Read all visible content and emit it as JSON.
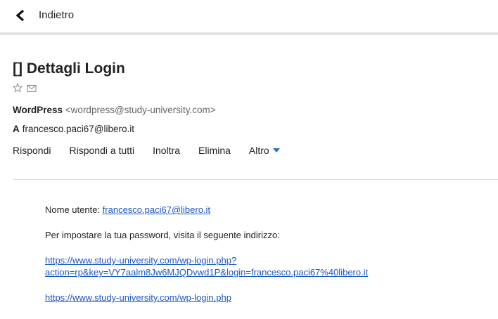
{
  "header": {
    "back_label": "Indietro"
  },
  "message": {
    "subject": "[] Dettagli Login",
    "from": {
      "name": "WordPress",
      "address": "<wordpress@study-university.com>"
    },
    "to": {
      "label": "A",
      "address": "francesco.paci67@libero.it"
    },
    "actions": [
      "Rispondi",
      "Rispondi a tutti",
      "Inoltra",
      "Elimina",
      "Altro"
    ],
    "body": {
      "username_label": "Nome utente:",
      "username_link": "francesco.paci67@libero.it",
      "password_text": "Per impostare la tua password, visita il seguente indirizzo:",
      "reset_link_line1": "https://www.study-university.com/wp-login.php?",
      "reset_link_line2": "action=rp&key=VY7aalm8Jw6MJQDvwd1P&login=francesco.paci67%40libero.it",
      "login_link": "https://www.study-university.com/wp-login.php"
    }
  },
  "icons": {
    "back": "chevron-left-icon",
    "star": "star-outline-icon",
    "envelope": "envelope-icon",
    "more": "caret-down-icon"
  },
  "colors": {
    "link": "#1a56c8",
    "caret": "#2a70c8",
    "divider": "#e2e2e2"
  }
}
